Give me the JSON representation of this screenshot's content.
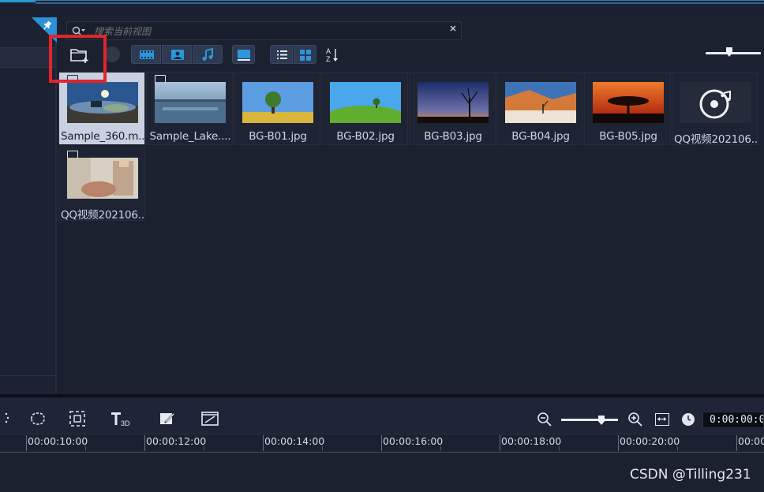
{
  "search": {
    "placeholder": "搜索当前视图",
    "value": ""
  },
  "toolbar": {
    "import_icon": "folder-plus-icon",
    "view_options": [
      "video-filter",
      "photo-filter",
      "audio-filter"
    ],
    "sort_label_top": "A",
    "sort_label_bottom": "Z"
  },
  "media": [
    {
      "label": "Sample_360.m...",
      "type": "video",
      "selected": true
    },
    {
      "label": "Sample_Lake....",
      "type": "video",
      "selected": false
    },
    {
      "label": "BG-B01.jpg",
      "type": "image",
      "selected": false
    },
    {
      "label": "BG-B02.jpg",
      "type": "image",
      "selected": false
    },
    {
      "label": "BG-B03.jpg",
      "type": "image",
      "selected": false
    },
    {
      "label": "BG-B04.jpg",
      "type": "image",
      "selected": false
    },
    {
      "label": "BG-B05.jpg",
      "type": "image",
      "selected": false
    },
    {
      "label": "QQ视频202106...",
      "type": "audio",
      "selected": false
    },
    {
      "label": "QQ视频202106...",
      "type": "video",
      "selected": false
    }
  ],
  "timeline": {
    "timecode": "0:00:00:0",
    "ruler": [
      "00:00:10:00",
      "00:00:12:00",
      "00:00:14:00",
      "00:00:16:00",
      "00:00:18:00",
      "00:00:20:00",
      "00:00"
    ]
  },
  "watermark": "CSDN @Tilling231",
  "colors": {
    "highlight": "#e2252b",
    "accent": "#2b95d8",
    "background": "#1c2130"
  }
}
